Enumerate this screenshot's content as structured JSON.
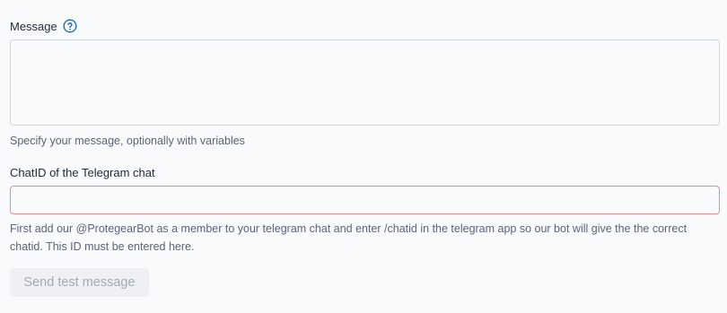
{
  "message": {
    "label": "Message",
    "value": "",
    "hint": "Specify your message, optionally with variables"
  },
  "chatid": {
    "label": "ChatID of the Telegram chat",
    "value": "",
    "hint": "First add our @ProtegearBot as a member to your telegram chat and enter /chatid in the telegram app so our bot will give the the correct chatid. This ID must be entered here."
  },
  "actions": {
    "send_test_label": "Send test message"
  },
  "colors": {
    "accent": "#1f6fb5",
    "error_border": "#e98b8b",
    "disabled_text": "#a4abb6"
  }
}
